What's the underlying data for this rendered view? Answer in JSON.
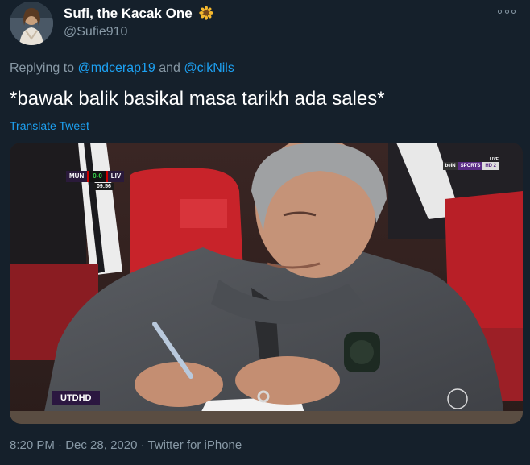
{
  "author": {
    "display_name": "Sufi, the Kacak One",
    "emoji_icon": "sunflower-icon",
    "handle": "@Sufie910"
  },
  "reply": {
    "prefix": "Replying to ",
    "mention_1": "@mdcerap19",
    "joiner": " and ",
    "mention_2": "@cikNils"
  },
  "tweet": {
    "text": "*bawak balik basikal masa tarikh ada sales*",
    "translate_label": "Translate Tweet"
  },
  "media": {
    "scoreboard": {
      "home": "MUN",
      "score": "0-0",
      "away": "LIV",
      "clock": "09:56"
    },
    "broadcaster": {
      "live": "LIVE",
      "name_1": "beIN",
      "name_2": "SPORTS",
      "name_3": "HD 2"
    },
    "channel_label": "UTDHD"
  },
  "footer": {
    "time": "8:20 PM",
    "sep_1": " · ",
    "date": "Dec 28, 2020",
    "sep_2": " · ",
    "source": "Twitter for iPhone"
  },
  "colors": {
    "background": "#15202b",
    "text_primary": "#ffffff",
    "text_secondary": "#8899a6",
    "link": "#1da1f2"
  }
}
